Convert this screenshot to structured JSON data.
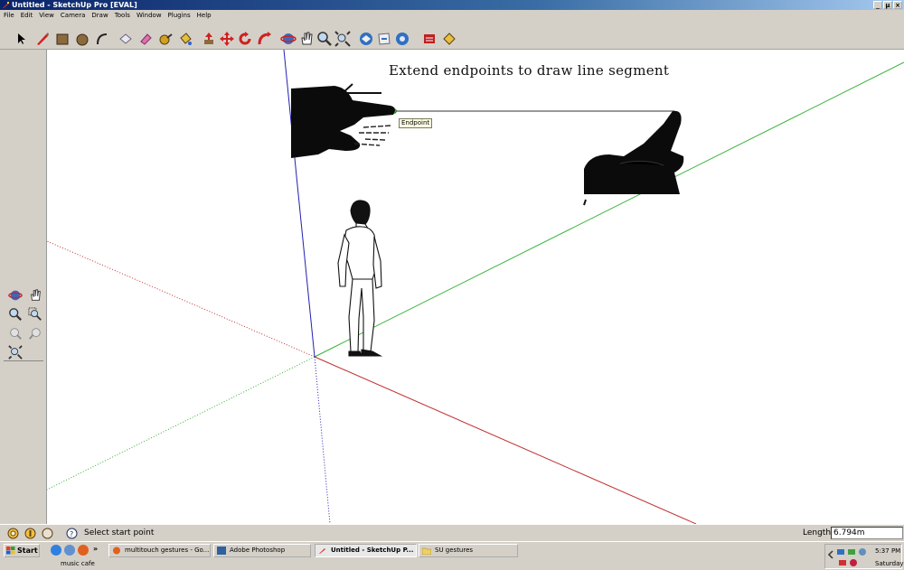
{
  "window": {
    "title": "Untitled - SketchUp Pro [EVAL]",
    "controls": [
      "_",
      "µ",
      "×"
    ]
  },
  "menu": [
    "File",
    "Edit",
    "View",
    "Camera",
    "Draw",
    "Tools",
    "Window",
    "Plugins",
    "Help"
  ],
  "toolbar": {
    "tools": [
      "select",
      "line",
      "rectangle",
      "circle",
      "arc",
      "make-component",
      "eraser",
      "tape-measure",
      "paint-bucket",
      "push-pull",
      "move",
      "rotate",
      "follow-me",
      "orbit",
      "pan",
      "zoom",
      "zoom-extents",
      "get-models",
      "share-model",
      "share-component",
      "extension-warehouse",
      "component-tool"
    ]
  },
  "canvas": {
    "caption": "Extend endpoints to draw line segment",
    "tooltip": "Endpoint",
    "axis_colors": {
      "red": "#c03030",
      "green": "#30b030",
      "blue": "#2020b0"
    }
  },
  "status": {
    "text": "Select start point",
    "length_label": "Length",
    "length_value": "6.794m"
  },
  "taskbar": {
    "start": "Start",
    "chevron": "»",
    "tasks": [
      {
        "label": "multitouch gestures - Go..."
      },
      {
        "label": "Adobe Photoshop"
      },
      {
        "label": "Untitled - SketchUp P..."
      },
      {
        "label": "SU gestures"
      }
    ],
    "sub_label": "music cafe",
    "time": "5:37 PM",
    "day": "Saturday"
  }
}
